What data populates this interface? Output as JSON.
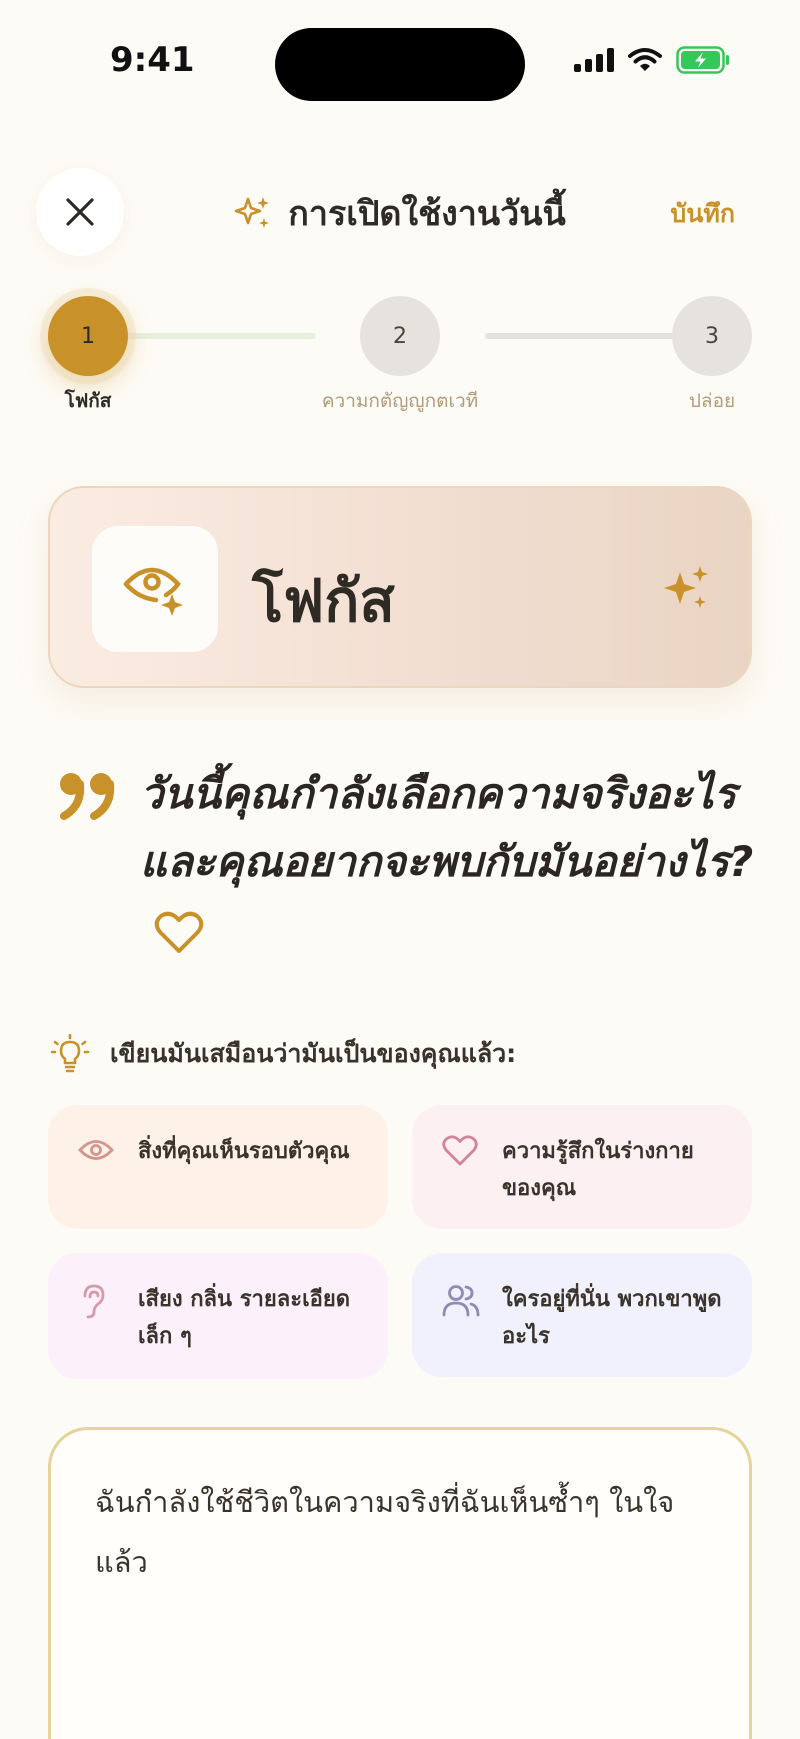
{
  "status_bar": {
    "time": "9:41"
  },
  "header": {
    "title": "การเปิดใช้งานวันนี้",
    "save_label": "บันทึก",
    "title_icon": "sparkles-icon",
    "close_icon": "close-icon"
  },
  "stepper": {
    "steps": [
      {
        "number": "1",
        "label": "โฟกัส",
        "state": "active"
      },
      {
        "number": "2",
        "label": "ความกตัญญูกตเวที",
        "state": "inactive"
      },
      {
        "number": "3",
        "label": "ปล่อย",
        "state": "inactive"
      }
    ]
  },
  "focus_card": {
    "title": "โฟกัส",
    "icon": "eye-sparkle-icon"
  },
  "question": {
    "text": "วันนี้คุณกำลังเลือกความจริงอะไร และคุณอยากจะพบกับมันอย่างไร?"
  },
  "hint": {
    "text": "เขียนมันเสมือนว่ามันเป็นของคุณแล้ว:",
    "icon": "lightbulb-icon"
  },
  "prompts": [
    {
      "label": "สิ่งที่คุณเห็นรอบตัวคุณ",
      "icon": "eye-icon"
    },
    {
      "label": "ความรู้สึกในร่างกายของคุณ",
      "icon": "heart-icon"
    },
    {
      "label": "เสียง กลิ่น รายละเอียดเล็ก ๆ",
      "icon": "ear-icon"
    },
    {
      "label": "ใครอยู่ที่นั่น พวกเขาพูดอะไร",
      "icon": "people-icon"
    }
  ],
  "entry": {
    "value": "ฉันกำลังใช้ชีวิตในความจริงที่ฉันเห็นซ้ำๆ ในใจแล้ว"
  },
  "colors": {
    "accent": "#c8912a",
    "background": "#fdfbf5",
    "text": "#2e2a24"
  }
}
